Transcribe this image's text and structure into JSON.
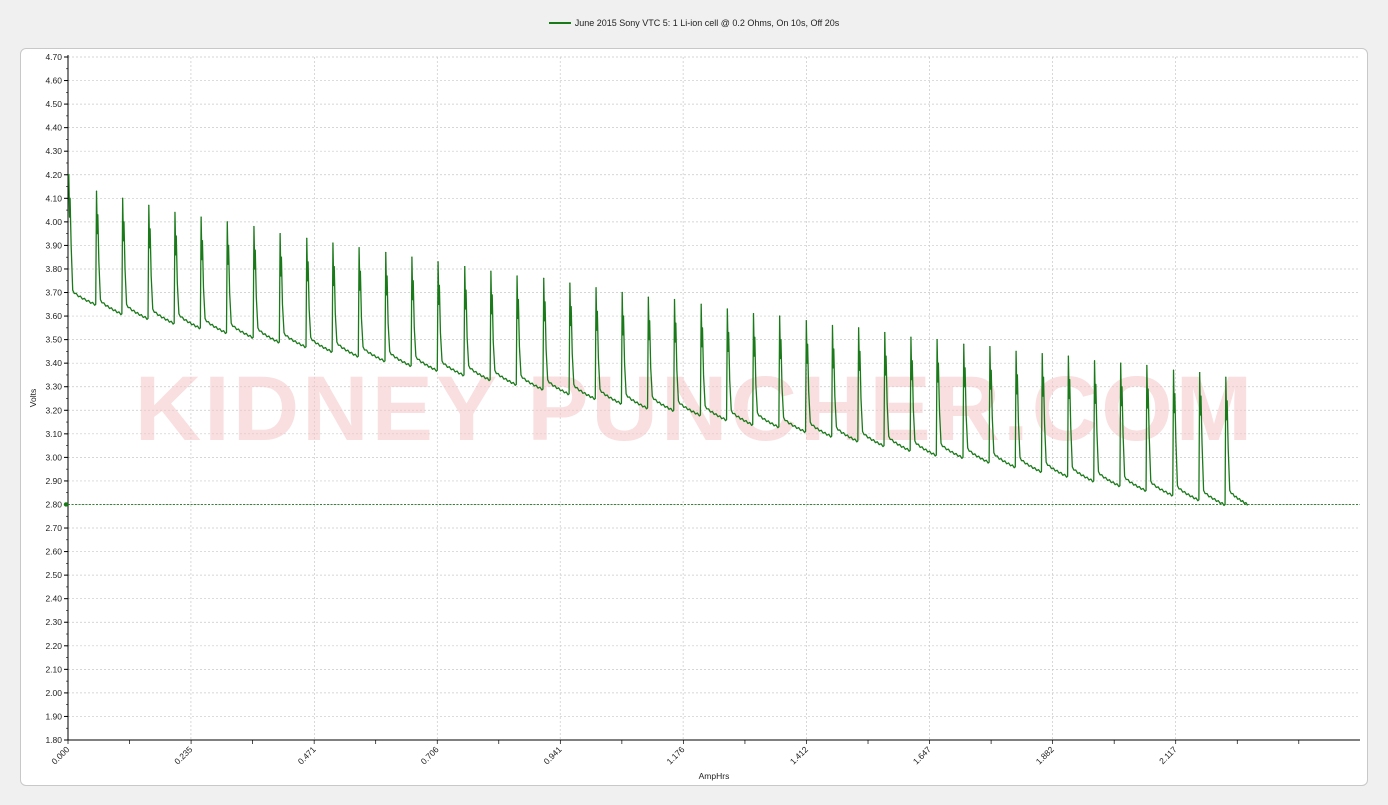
{
  "legend": {
    "label": "June 2015 Sony VTC 5: 1 Li-ion cell @ 0.2 Ohms, On 10s, Off 20s"
  },
  "watermark": "KIDNEY PUNCHER.COM",
  "colors": {
    "series": "#1a7a1a",
    "grid": "#c8c8c8",
    "background": "#ffffff",
    "panel": "#f0f0f0"
  },
  "chart_data": {
    "type": "line",
    "xlabel": "AmpHrs",
    "ylabel": "Volts",
    "xlim": [
      0,
      2.47
    ],
    "ylim": [
      1.8,
      4.7
    ],
    "x_ticks": [
      "0.000",
      "0.235",
      "0.471",
      "0.706",
      "0.941",
      "1.176",
      "1.412",
      "1.647",
      "1.882",
      "2.117"
    ],
    "y_ticks": [
      "4.70",
      "4.60",
      "4.50",
      "4.40",
      "4.30",
      "4.20",
      "4.10",
      "4.00",
      "3.90",
      "3.80",
      "3.70",
      "3.60",
      "3.50",
      "3.40",
      "3.30",
      "3.20",
      "3.10",
      "3.00",
      "2.90",
      "2.80",
      "2.70",
      "2.60",
      "2.50",
      "2.40",
      "2.30",
      "2.20",
      "2.10",
      "2.00",
      "1.90",
      "1.80"
    ],
    "grid": true,
    "cutoff_line": 2.8,
    "series": [
      {
        "name": "June 2015 Sony VTC 5: 1 Li-ion cell @ 0.2 Ohms, On 10s, Off 20s",
        "pulse_x": [
          0.0,
          0.053,
          0.103,
          0.153,
          0.203,
          0.253,
          0.303,
          0.354,
          0.404,
          0.455,
          0.505,
          0.555,
          0.606,
          0.656,
          0.706,
          0.757,
          0.807,
          0.857,
          0.908,
          0.958,
          1.008,
          1.058,
          1.108,
          1.158,
          1.209,
          1.259,
          1.309,
          1.359,
          1.41,
          1.46,
          1.51,
          1.56,
          1.61,
          1.66,
          1.711,
          1.761,
          1.811,
          1.861,
          1.911,
          1.961,
          2.011,
          2.061,
          2.112,
          2.162,
          2.212
        ],
        "pulse_y_peak": [
          4.2,
          4.13,
          4.1,
          4.07,
          4.04,
          4.02,
          4.0,
          3.98,
          3.95,
          3.93,
          3.91,
          3.89,
          3.87,
          3.85,
          3.83,
          3.81,
          3.79,
          3.77,
          3.76,
          3.74,
          3.72,
          3.7,
          3.68,
          3.67,
          3.65,
          3.63,
          3.61,
          3.6,
          3.58,
          3.56,
          3.55,
          3.53,
          3.51,
          3.5,
          3.48,
          3.47,
          3.45,
          3.44,
          3.43,
          3.41,
          3.4,
          3.39,
          3.37,
          3.36,
          3.34
        ],
        "pulse_y_low": [
          3.65,
          3.61,
          3.59,
          3.57,
          3.55,
          3.53,
          3.51,
          3.49,
          3.47,
          3.45,
          3.43,
          3.41,
          3.39,
          3.37,
          3.35,
          3.33,
          3.31,
          3.29,
          3.27,
          3.25,
          3.23,
          3.21,
          3.2,
          3.18,
          3.16,
          3.14,
          3.13,
          3.11,
          3.09,
          3.07,
          3.05,
          3.03,
          3.01,
          3.0,
          2.98,
          2.96,
          2.94,
          2.92,
          2.9,
          2.88,
          2.86,
          2.84,
          2.82,
          2.8,
          2.8
        ],
        "end_x": 2.257
      }
    ]
  }
}
